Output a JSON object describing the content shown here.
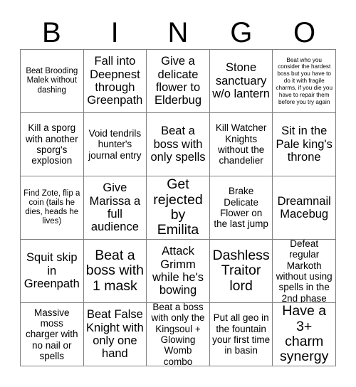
{
  "header": {
    "letters": [
      "B",
      "I",
      "N",
      "G",
      "O"
    ]
  },
  "grid": {
    "columns": 5,
    "rows": 5,
    "cells": [
      {
        "text": "Beat Brooding Malek without dashing",
        "size": "sm"
      },
      {
        "text": "Fall into Deepnest through Greenpath",
        "size": "lg"
      },
      {
        "text": "Give a delicate flower to Elderbug",
        "size": "lg"
      },
      {
        "text": "Stone sanctuary w/o lantern",
        "size": "lg"
      },
      {
        "text": "Beat who you consider the hardest boss but you have to do it with fragile charms, if you die you have to repair them before you try again",
        "size": "xs"
      },
      {
        "text": "Kill a sporg with another sporg's explosion",
        "size": "md"
      },
      {
        "text": "Void tendrils hunter's journal entry",
        "size": "md"
      },
      {
        "text": "Beat a boss with only spells",
        "size": "lg"
      },
      {
        "text": "Kill Watcher Knights without the chandelier",
        "size": "md"
      },
      {
        "text": "Sit in the Pale king's throne",
        "size": "lg"
      },
      {
        "text": "Find Zote, flip a coin (tails he dies, heads he lives)",
        "size": "sm"
      },
      {
        "text": "Give Marissa a full audience",
        "size": "lg"
      },
      {
        "text": "Get rejected by Emilita",
        "size": "xl"
      },
      {
        "text": "Brake Delicate Flower on the last jump",
        "size": "md"
      },
      {
        "text": "Dreamnail Macebug",
        "size": "lg"
      },
      {
        "text": "Squit skip in Greenpath",
        "size": "lg"
      },
      {
        "text": "Beat a boss with 1 mask",
        "size": "xl"
      },
      {
        "text": "Attack Grimm while he's bowing",
        "size": "lg"
      },
      {
        "text": "Dashless Traitor lord",
        "size": "xl"
      },
      {
        "text": "Defeat regular Markoth without using spells in the 2nd phase",
        "size": "md"
      },
      {
        "text": "Massive moss charger with no nail or spells",
        "size": "md"
      },
      {
        "text": "Beat False Knight with only one hand",
        "size": "lg"
      },
      {
        "text": "Beat a boss with only the Kingsoul + Glowing Womb combo",
        "size": "md"
      },
      {
        "text": "Put all geo in the fountain your first time in basin",
        "size": "md"
      },
      {
        "text": "Have a 3+ charm synergy",
        "size": "xl"
      }
    ]
  },
  "colors": {
    "background": "#ffffff",
    "text": "#000000",
    "grid_line": "#808080"
  }
}
